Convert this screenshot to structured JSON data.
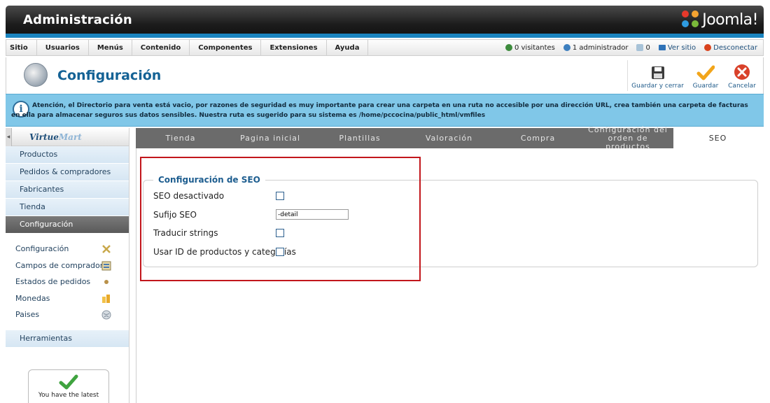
{
  "header": {
    "title": "Administración",
    "brand": "Joomla!"
  },
  "menubar": {
    "items": [
      "Sitio",
      "Usuarios",
      "Menús",
      "Contenido",
      "Componentes",
      "Extensiones",
      "Ayuda"
    ],
    "visitors": "0 visitantes",
    "admins": "1 administrador",
    "messages": "0",
    "view_site": "Ver sitio",
    "logout": "Desconectar"
  },
  "toolbar": {
    "title": "Configuración",
    "save_close": "Guardar y cerrar",
    "save": "Guardar",
    "cancel": "Cancelar"
  },
  "notice": {
    "text": "Atención, el Directorio para venta está vacio, por razones de seguridad es muy importante para crear una carpeta en una ruta no accesible por una dirección URL, crea también una carpeta de facturas en ella para almacenar seguros sus datos sensibles. Nuestra ruta es sugerido para su sistema es /home/pccocina/public_html/vmfiles"
  },
  "sidebar": {
    "brand_a": "Virtue",
    "brand_b": "Mart",
    "items": [
      "Productos",
      "Pedidos & compradores",
      "Fabricantes",
      "Tienda",
      "Configuración"
    ],
    "sub_items": [
      "Configuración",
      "Campos de comprador",
      "Estados de pedidos",
      "Monedas",
      "Paises"
    ],
    "tools": "Herramientas",
    "latest": "You have the latest"
  },
  "tabs": [
    "Tienda",
    "Pagina inicial",
    "Plantillas",
    "Valoración",
    "Compra",
    "Configuración del orden de productos",
    "SEO"
  ],
  "seo": {
    "legend": "Configuración de SEO",
    "disabled_label": "SEO desactivado",
    "suffix_label": "Sufijo SEO",
    "suffix_value": "-detail",
    "translate_label": "Traducir strings",
    "use_ids_label": "Usar ID de productos y categorías"
  },
  "colors": {
    "accent": "#1a84bf",
    "notice": "#80c7e8",
    "highlight": "#c2161c",
    "title": "#146295"
  }
}
